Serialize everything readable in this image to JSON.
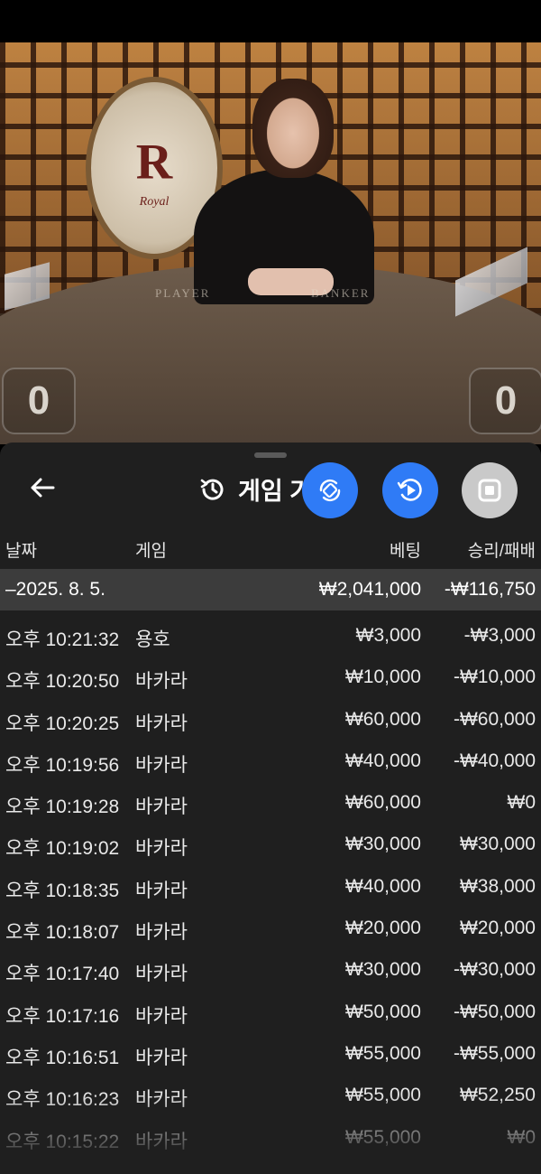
{
  "video": {
    "emblem_letter": "R",
    "emblem_text": "Royal",
    "table_labels": [
      "PLAYER",
      "BANKER"
    ],
    "player_score": "0",
    "banker_score": "0"
  },
  "panel": {
    "title": "게임 기",
    "icons": {
      "back": "back-arrow-icon",
      "history": "history-icon",
      "rotate": "rotate-screen-icon",
      "replay": "replay-video-icon",
      "stop": "stop-icon"
    },
    "headers": {
      "date": "날짜",
      "game": "게임",
      "bet": "베팅",
      "result": "승리/패배"
    },
    "date_group": {
      "label": "–2025. 8. 5.",
      "bet_total": "₩2,041,000",
      "result_total": "-₩116,750"
    },
    "rows": [
      {
        "time": "오후 10:21:32",
        "game": "용호",
        "bet": "₩3,000",
        "result": "-₩3,000"
      },
      {
        "time": "오후 10:20:50",
        "game": "바카라",
        "bet": "₩10,000",
        "result": "-₩10,000"
      },
      {
        "time": "오후 10:20:25",
        "game": "바카라",
        "bet": "₩60,000",
        "result": "-₩60,000"
      },
      {
        "time": "오후 10:19:56",
        "game": "바카라",
        "bet": "₩40,000",
        "result": "-₩40,000"
      },
      {
        "time": "오후 10:19:28",
        "game": "바카라",
        "bet": "₩60,000",
        "result": "₩0"
      },
      {
        "time": "오후 10:19:02",
        "game": "바카라",
        "bet": "₩30,000",
        "result": "₩30,000"
      },
      {
        "time": "오후 10:18:35",
        "game": "바카라",
        "bet": "₩40,000",
        "result": "₩38,000"
      },
      {
        "time": "오후 10:18:07",
        "game": "바카라",
        "bet": "₩20,000",
        "result": "₩20,000"
      },
      {
        "time": "오후 10:17:40",
        "game": "바카라",
        "bet": "₩30,000",
        "result": "-₩30,000"
      },
      {
        "time": "오후 10:17:16",
        "game": "바카라",
        "bet": "₩50,000",
        "result": "-₩50,000"
      },
      {
        "time": "오후 10:16:51",
        "game": "바카라",
        "bet": "₩55,000",
        "result": "-₩55,000"
      },
      {
        "time": "오후 10:16:23",
        "game": "바카라",
        "bet": "₩55,000",
        "result": "₩52,250"
      },
      {
        "time": "오후 10:15:22",
        "game": "바카라",
        "bet": "₩55,000",
        "result": "₩0"
      }
    ]
  },
  "colors": {
    "panel_bg": "#1f1f1f",
    "date_row_bg": "#3c3c3c",
    "fab_blue": "#2f7bf6",
    "fab_gray": "#c9c9c9"
  }
}
